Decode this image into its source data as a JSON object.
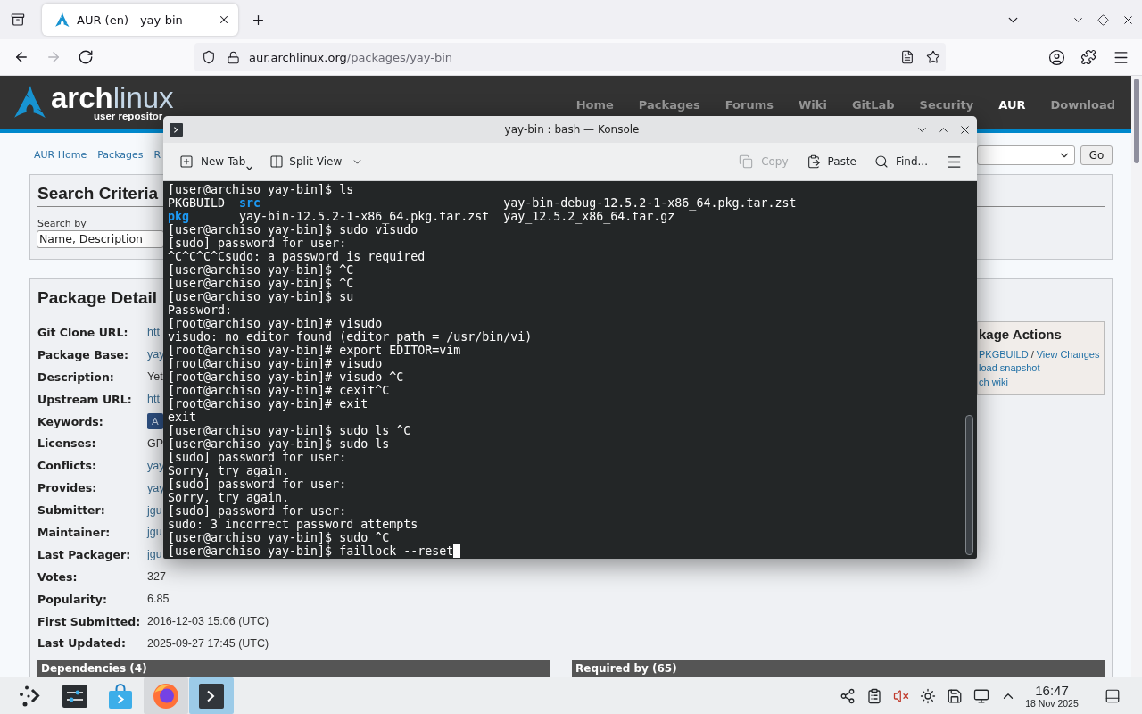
{
  "browser": {
    "tabs": [
      {
        "title": "AUR (en) - yay-bin",
        "selected": true
      }
    ],
    "nav_buttons": [
      {
        "kind": "back",
        "disabled": false
      },
      {
        "kind": "forward",
        "disabled": true
      },
      {
        "kind": "reload",
        "disabled": false
      }
    ],
    "url": {
      "host": "aur.archlinux.org",
      "path": "/packages/yay-bin"
    }
  },
  "page": {
    "logo": {
      "wordmark": "**arch**linux",
      "tagline": "user repositor"
    },
    "nav": [
      {
        "label": "Home",
        "selected": false
      },
      {
        "label": "Packages",
        "selected": false
      },
      {
        "label": "Forums",
        "selected": false
      },
      {
        "label": "Wiki",
        "selected": false
      },
      {
        "label": "GitLab",
        "selected": false
      },
      {
        "label": "Security",
        "selected": false
      },
      {
        "label": "AUR",
        "selected": true
      },
      {
        "label": "Download",
        "selected": false
      }
    ],
    "breadcrumbs": [
      "AUR Home",
      "Packages",
      "R"
    ],
    "go_button": "Go",
    "search_panel": {
      "title": "Search Criteria",
      "field_label": "Search by",
      "field_value": "Name, Description"
    },
    "details_panel": {
      "title": "Package Detail",
      "rows": [
        {
          "label": "Git Clone URL:",
          "value": "htt",
          "kind": "link"
        },
        {
          "label": "Package Base:",
          "value": "yay",
          "kind": "link"
        },
        {
          "label": "Description:",
          "value": "Yet",
          "kind": "text"
        },
        {
          "label": "Upstream URL:",
          "value": "htt",
          "kind": "link"
        },
        {
          "label": "Keywords:",
          "value": "A",
          "kind": "tag"
        },
        {
          "label": "Licenses:",
          "value": "GP",
          "kind": "text"
        },
        {
          "label": "Conflicts:",
          "value": "yay",
          "kind": "link"
        },
        {
          "label": "Provides:",
          "value": "yay",
          "kind": "link"
        },
        {
          "label": "Submitter:",
          "value": "jgu",
          "kind": "link"
        },
        {
          "label": "Maintainer:",
          "value": "jgu",
          "kind": "link"
        },
        {
          "label": "Last Packager:",
          "value": "jgu",
          "kind": "link"
        },
        {
          "label": "Votes:",
          "value": "327",
          "kind": "text"
        },
        {
          "label": "Popularity:",
          "value": "6.85",
          "kind": "text"
        },
        {
          "label": "First Submitted:",
          "value": "2016-12-03 15:06 (UTC)",
          "kind": "text"
        },
        {
          "label": "Last Updated:",
          "value": "2025-09-27 17:45 (UTC)",
          "kind": "text"
        }
      ]
    },
    "actions": {
      "title": "kage Actions",
      "lines": [
        [
          {
            "text": "PKGBUILD",
            "kind": "link"
          },
          {
            "text": "/",
            "kind": "text"
          },
          {
            "text": "View Changes",
            "kind": "link"
          }
        ],
        [
          {
            "text": "load snapshot",
            "kind": "link"
          }
        ],
        [
          {
            "text": "ch wiki",
            "kind": "link"
          }
        ]
      ]
    },
    "sections": [
      "Dependencies (4)",
      "Required by (65)"
    ]
  },
  "konsole": {
    "title": "yay-bin : bash — Konsole",
    "toolbar_left": [
      {
        "kind": "new-tab",
        "label": "New Tab",
        "disabled": false
      },
      {
        "kind": "split-view",
        "label": "Split View",
        "disabled": false
      }
    ],
    "toolbar_right": [
      {
        "kind": "copy",
        "label": "Copy",
        "disabled": true
      },
      {
        "kind": "paste",
        "label": "Paste",
        "disabled": false
      },
      {
        "kind": "find",
        "label": "Find...",
        "disabled": false
      },
      {
        "kind": "menu",
        "disabled": false
      }
    ],
    "lines": [
      {
        "kind": "text",
        "text": "[user@archiso yay-bin]$ ls"
      },
      {
        "kind": "listing",
        "columns": [
          [
            {
              "name": "PKGBUILD",
              "kind": "file"
            },
            {
              "name": "pkg",
              "kind": "dir"
            }
          ],
          [
            {
              "name": "src",
              "kind": "dir"
            },
            {
              "name": "yay-bin-12.5.2-1-x86_64.pkg.tar.zst",
              "kind": "file"
            }
          ],
          [
            {
              "name": "yay-bin-debug-12.5.2-1-x86_64.pkg.tar.zst",
              "kind": "file"
            },
            {
              "name": "yay_12.5.2_x86_64.tar.gz",
              "kind": "file"
            }
          ]
        ]
      },
      {
        "kind": "text",
        "text": "[user@archiso yay-bin]$ sudo visudo"
      },
      {
        "kind": "text",
        "text": "[sudo] password for user:"
      },
      {
        "kind": "text",
        "text": "^C^C^C^Csudo: a password is required"
      },
      {
        "kind": "text",
        "text": "[user@archiso yay-bin]$ ^C"
      },
      {
        "kind": "text",
        "text": "[user@archiso yay-bin]$ ^C"
      },
      {
        "kind": "text",
        "text": "[user@archiso yay-bin]$ su"
      },
      {
        "kind": "text",
        "text": "Password:"
      },
      {
        "kind": "text",
        "text": "[root@archiso yay-bin]# visudo"
      },
      {
        "kind": "text",
        "text": "visudo: no editor found (editor path = /usr/bin/vi)"
      },
      {
        "kind": "text",
        "text": "[root@archiso yay-bin]# export EDITOR=vim"
      },
      {
        "kind": "text",
        "text": "[root@archiso yay-bin]# visudo"
      },
      {
        "kind": "text",
        "text": "[root@archiso yay-bin]# visudo ^C"
      },
      {
        "kind": "text",
        "text": "[root@archiso yay-bin]# cexit^C"
      },
      {
        "kind": "text",
        "text": "[root@archiso yay-bin]# exit"
      },
      {
        "kind": "text",
        "text": "exit"
      },
      {
        "kind": "text",
        "text": "[user@archiso yay-bin]$ sudo ls ^C"
      },
      {
        "kind": "text",
        "text": "[user@archiso yay-bin]$ sudo ls"
      },
      {
        "kind": "text",
        "text": "[sudo] password for user:"
      },
      {
        "kind": "text",
        "text": "Sorry, try again."
      },
      {
        "kind": "text",
        "text": "[sudo] password for user:"
      },
      {
        "kind": "text",
        "text": "Sorry, try again."
      },
      {
        "kind": "text",
        "text": "[sudo] password for user:"
      },
      {
        "kind": "text",
        "text": "sudo: 3 incorrect password attempts"
      },
      {
        "kind": "text",
        "text": "[user@archiso yay-bin]$ sudo ^C"
      },
      {
        "kind": "input",
        "text": "[user@archiso yay-bin]$ faillock --reset"
      }
    ]
  },
  "taskbar": {
    "apps": [
      {
        "kind": "launcher",
        "running": false,
        "selected": false
      },
      {
        "kind": "settings",
        "running": false,
        "selected": false
      },
      {
        "kind": "store",
        "running": false,
        "selected": false
      },
      {
        "kind": "browser",
        "running": true,
        "selected": false
      },
      {
        "kind": "terminal",
        "running": true,
        "selected": true
      }
    ],
    "tray": [
      {
        "kind": "connect"
      },
      {
        "kind": "clipboard"
      },
      {
        "kind": "volume",
        "muted": true
      },
      {
        "kind": "brightness"
      },
      {
        "kind": "disk"
      },
      {
        "kind": "network"
      },
      {
        "kind": "expand"
      }
    ],
    "clock": {
      "time": "16:47",
      "date": "18 Nov 2025"
    }
  }
}
